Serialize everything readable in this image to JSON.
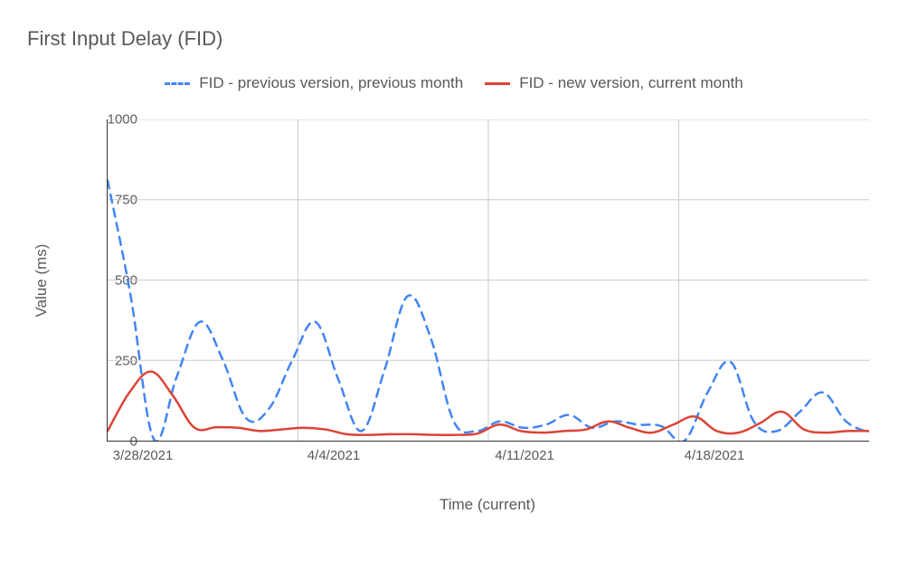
{
  "chart_data": {
    "type": "line",
    "title": "First Input Delay (FID)",
    "xlabel": "Time (current)",
    "ylabel": "Value (ms)",
    "ylim": [
      0,
      1000
    ],
    "x_tick_labels": [
      "3/28/2021",
      "4/4/2021",
      "4/11/2021",
      "4/18/2021"
    ],
    "x_tick_positions": [
      0,
      7,
      14,
      21
    ],
    "y_ticks": [
      0,
      250,
      500,
      750,
      1000
    ],
    "x_range": [
      0,
      28
    ],
    "series": [
      {
        "name": "FID - previous version, previous month",
        "style": "dashed",
        "color": "#4285f4",
        "values": [
          810,
          450,
          5,
          200,
          370,
          250,
          70,
          100,
          250,
          370,
          190,
          30,
          220,
          450,
          320,
          60,
          30,
          60,
          40,
          50,
          80,
          40,
          60,
          50,
          45,
          0,
          150,
          245,
          60,
          30,
          90,
          150,
          60,
          25
        ]
      },
      {
        "name": "FID - new version, current month",
        "style": "solid",
        "color": "#db4437",
        "values": [
          30,
          150,
          215,
          140,
          40,
          42,
          40,
          30,
          35,
          40,
          35,
          20,
          18,
          20,
          20,
          18,
          18,
          22,
          50,
          30,
          25,
          30,
          35,
          60,
          40,
          25,
          50,
          75,
          30,
          25,
          55,
          90,
          35,
          25,
          30,
          30
        ]
      }
    ],
    "legend": {
      "items": [
        "FID - previous version, previous month",
        "FID - new version, current month"
      ]
    }
  }
}
